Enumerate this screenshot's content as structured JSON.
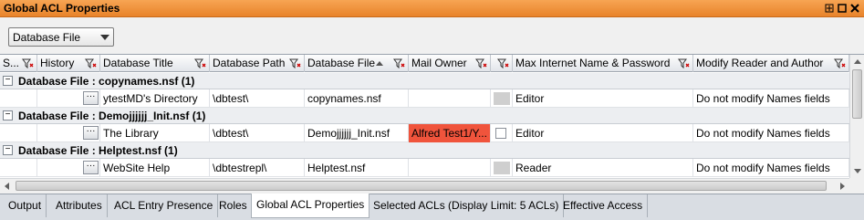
{
  "window": {
    "title": "Global ACL Properties",
    "buttons": [
      "pin",
      "maximize",
      "close"
    ]
  },
  "toolbar": {
    "group_by": "Database File"
  },
  "columns": [
    {
      "label": "S..."
    },
    {
      "label": "History"
    },
    {
      "label": "Database Title"
    },
    {
      "label": "Database Path"
    },
    {
      "label": "Database File"
    },
    {
      "label": "Mail Owner"
    },
    {
      "label": ""
    },
    {
      "label": "Max Internet Name & Password"
    },
    {
      "label": "Modify Reader and Author"
    }
  ],
  "groups": [
    {
      "label": "Database File : copynames.nsf (1)",
      "row": {
        "title": "ytestMD's Directory",
        "path": "\\dbtest\\",
        "file": "copynames.nsf",
        "mail_owner": "",
        "max_internet": "Editor",
        "modify_reader": "Do not modify Names fields"
      }
    },
    {
      "label": "Database File : Demojjjjjj_Init.nsf (1)",
      "row": {
        "title": "The Library",
        "path": "\\dbtest\\",
        "file": "Demojjjjjj_Init.nsf",
        "mail_owner": "Alfred Test1/Y...",
        "max_internet": "Editor",
        "modify_reader": "Do not modify Names fields"
      }
    },
    {
      "label": "Database File : Helptest.nsf (1)",
      "row": {
        "title": "WebSite Help",
        "path": "\\dbtestrepl\\",
        "file": "Helptest.nsf",
        "mail_owner": "",
        "max_internet": "Reader",
        "modify_reader": "Do not modify Names fields"
      }
    }
  ],
  "tabs": [
    {
      "label": "Output"
    },
    {
      "label": "Attributes"
    },
    {
      "label": "ACL Entry Presence"
    },
    {
      "label": "Roles"
    },
    {
      "label": "Global ACL Properties"
    },
    {
      "label": "Selected ACLs (Display Limit: 5 ACLs)"
    },
    {
      "label": "Effective Access"
    }
  ],
  "colors": {
    "title_bar": "#f0943d",
    "mail_owner_highlight": "#f0543c"
  }
}
